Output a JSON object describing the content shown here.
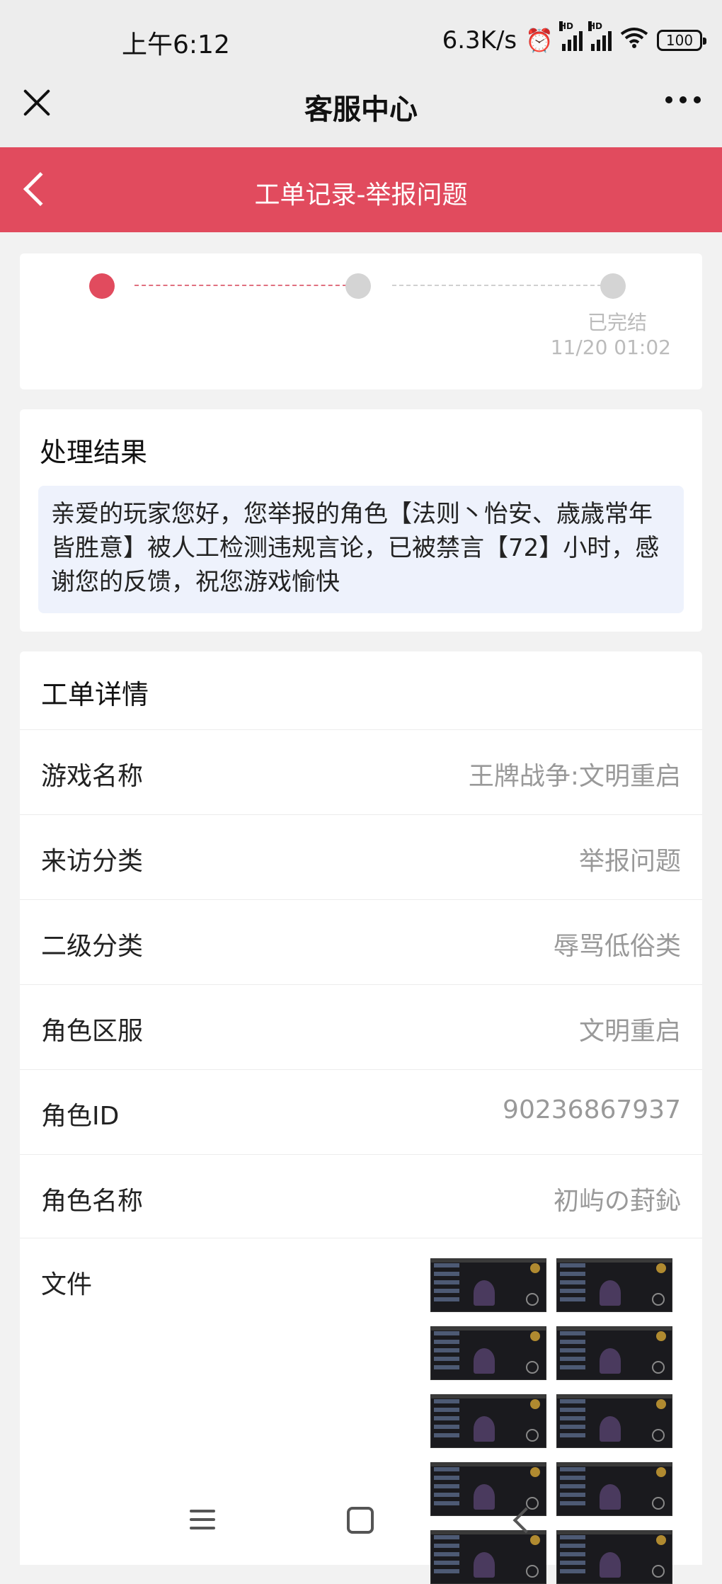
{
  "status_bar": {
    "time": "上午6:12",
    "net_speed": "6.3K/s",
    "hd_label": "HD",
    "battery": "100"
  },
  "nav": {
    "title": "客服中心"
  },
  "header": {
    "title": "工单记录-举报问题",
    "color": "#e14b5e"
  },
  "progress": {
    "status_label": "已完结",
    "status_time": "11/20 01:02"
  },
  "result": {
    "title": "处理结果",
    "message": "亲爱的玩家您好，您举报的角色【法则丶怡安、歳歳常年皆胜意】被人工检测违规言论，已被禁言【72】小时，感谢您的反馈，祝您游戏愉快"
  },
  "details": {
    "title": "工单详情",
    "rows": [
      {
        "label": "游戏名称",
        "value": "王牌战争:文明重启"
      },
      {
        "label": "来访分类",
        "value": "举报问题"
      },
      {
        "label": "二级分类",
        "value": "辱骂低俗类"
      },
      {
        "label": "角色区服",
        "value": "文明重启"
      },
      {
        "label": "角色ID",
        "value": "90236867937"
      },
      {
        "label": "角色名称",
        "value": "初屿の葑鈊"
      }
    ],
    "file_label": "文件"
  }
}
